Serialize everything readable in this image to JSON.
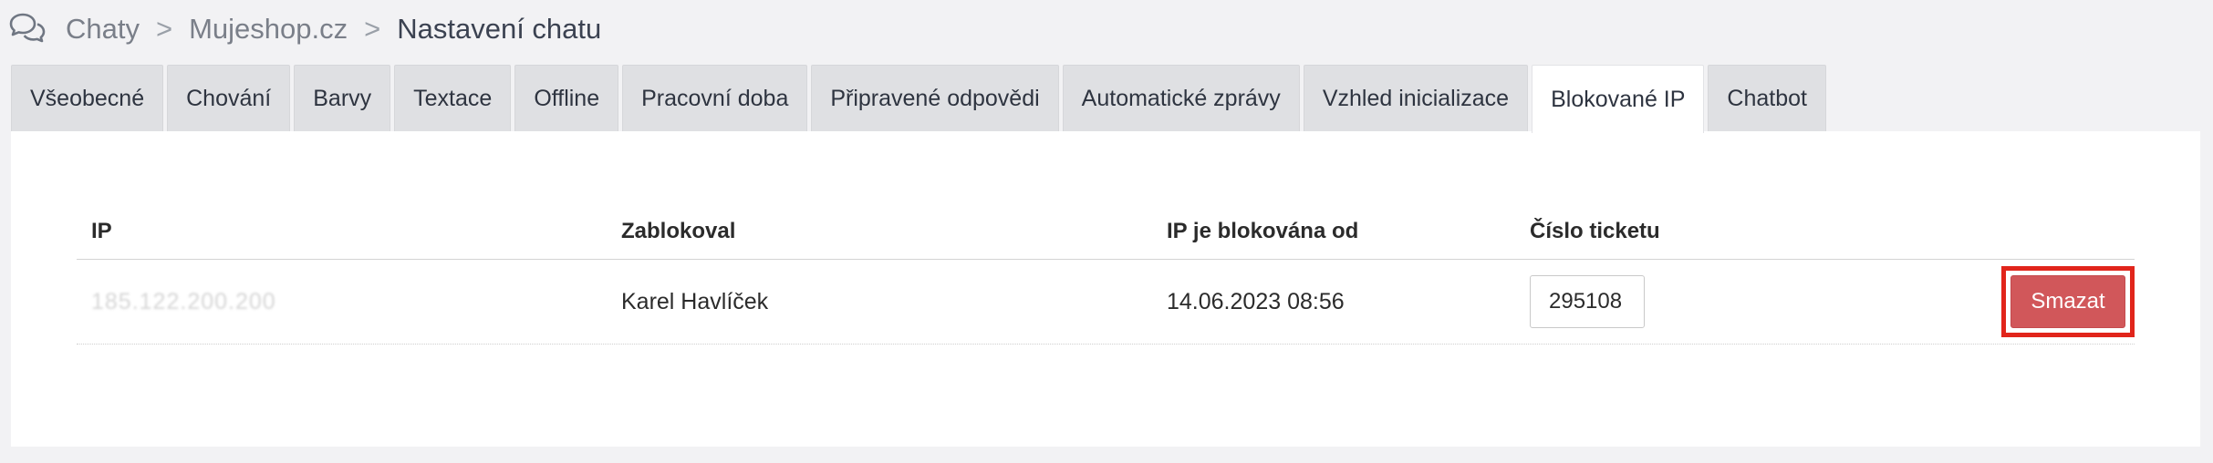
{
  "breadcrumb": {
    "items": [
      "Chaty",
      "Mujeshop.cz",
      "Nastavení chatu"
    ],
    "separator": ">"
  },
  "tabs": [
    {
      "label": "Všeobecné"
    },
    {
      "label": "Chování"
    },
    {
      "label": "Barvy"
    },
    {
      "label": "Textace"
    },
    {
      "label": "Offline"
    },
    {
      "label": "Pracovní doba"
    },
    {
      "label": "Připravené odpovědi"
    },
    {
      "label": "Automatické zprávy"
    },
    {
      "label": "Vzhled inicializace"
    },
    {
      "label": "Blokované IP",
      "active": true
    },
    {
      "label": "Chatbot"
    }
  ],
  "table": {
    "headers": {
      "ip": "IP",
      "blocked_by": "Zablokoval",
      "blocked_since": "IP je blokována od",
      "ticket": "Číslo ticketu"
    },
    "rows": [
      {
        "ip": "185.122.200.200",
        "blocked_by": "Karel Havlíček",
        "blocked_since": "14.06.2023 08:56",
        "ticket": "295108",
        "delete_label": "Smazat"
      }
    ]
  },
  "colors": {
    "delete_button": "#d1575a",
    "highlight_border": "#e1251b",
    "active_tab": "#ffffff",
    "inactive_tab": "#dfe0e3"
  }
}
